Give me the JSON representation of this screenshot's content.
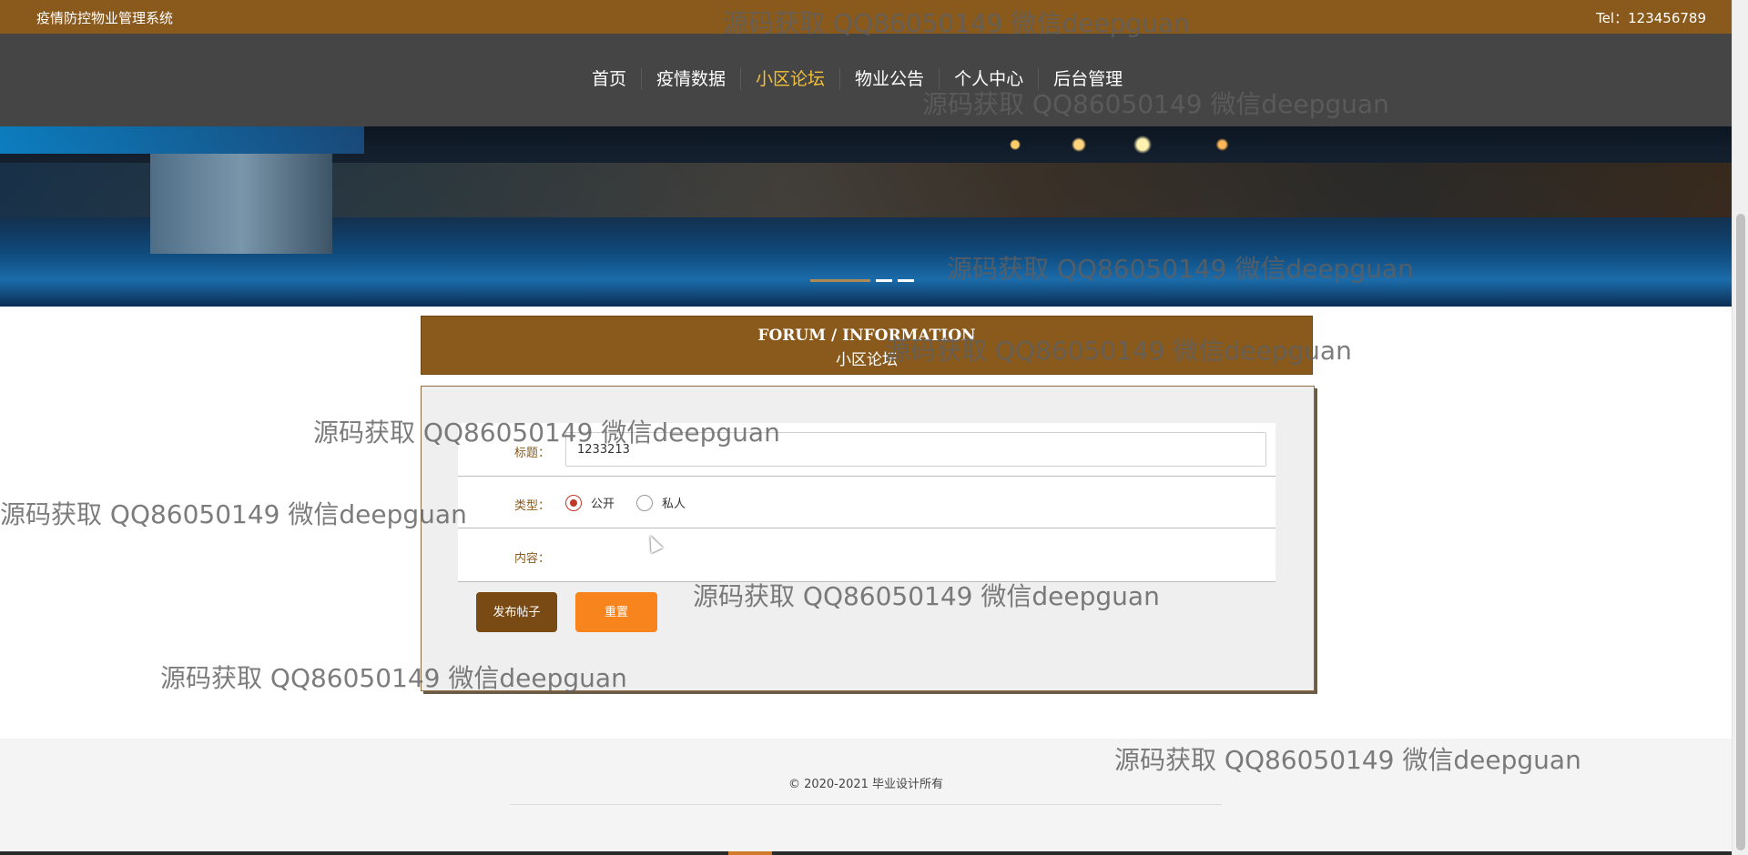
{
  "header": {
    "system_title": "疫情防控物业管理系统",
    "tel": "Tel：123456789"
  },
  "nav": {
    "items": [
      "首页",
      "疫情数据",
      "小区论坛",
      "物业公告",
      "个人中心",
      "后台管理"
    ],
    "active": "小区论坛"
  },
  "forum": {
    "title_en": "FORUM / INFORMATION",
    "title_cn": "小区论坛"
  },
  "form": {
    "title_label": "标题：",
    "title_value": "1233213",
    "type_label": "类型：",
    "type_options": [
      "公开",
      "私人"
    ],
    "type_selected": "公开",
    "content_label": "内容：",
    "post_button": "发布帖子",
    "reset_button": "重置"
  },
  "footer": {
    "copyright": "© 2020-2021 毕业设计所有"
  },
  "watermark": {
    "text": "源码获取 QQ86050149 微信deepguan"
  },
  "colors": {
    "brand_brown": "#8a5a1c",
    "nav_bg": "#454545",
    "nav_active": "#f2c038",
    "reset_orange": "#f8841e",
    "radio_selected": "#c0392b"
  }
}
